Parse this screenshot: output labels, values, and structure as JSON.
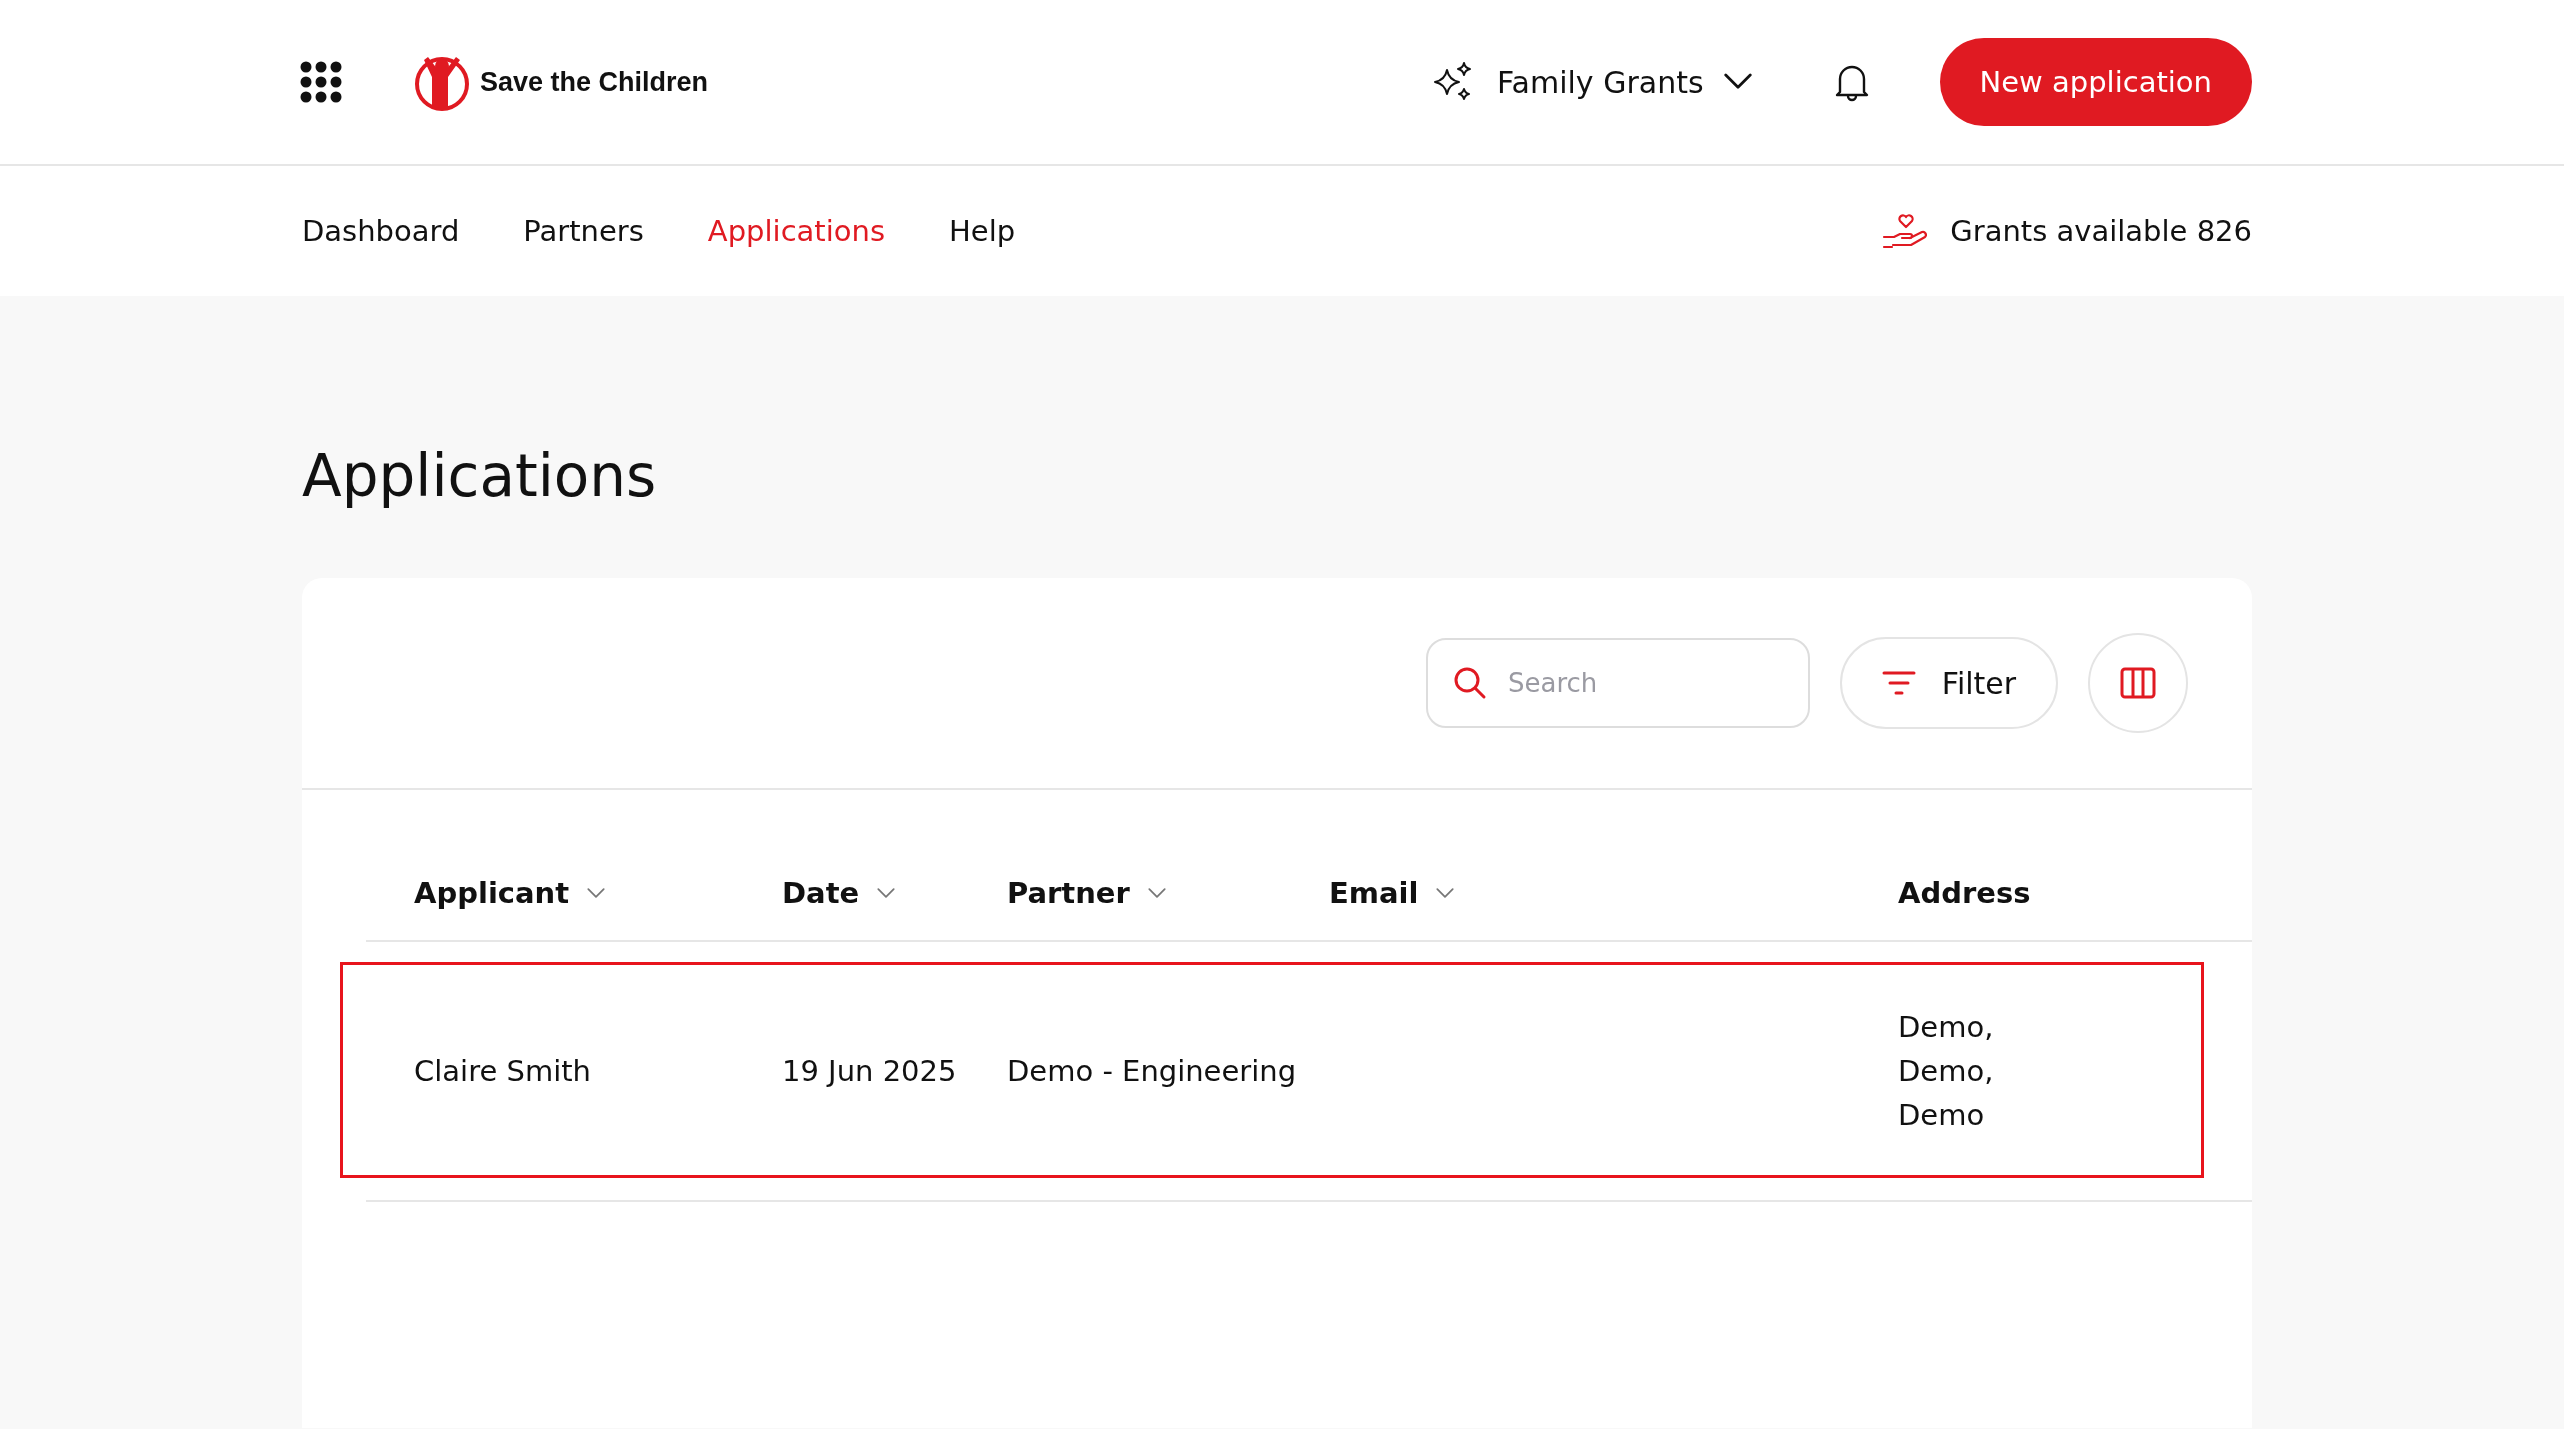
{
  "header": {
    "logo_text": "Save the Children",
    "programme": "Family Grants",
    "new_button": "New application"
  },
  "nav": {
    "items": [
      {
        "label": "Dashboard",
        "selected": false
      },
      {
        "label": "Partners",
        "selected": false
      },
      {
        "label": "Applications",
        "selected": true
      },
      {
        "label": "Help",
        "selected": false
      }
    ],
    "grants_label": "Grants available 826"
  },
  "page_title": "Applications",
  "toolbar": {
    "search": {
      "placeholder": "Search"
    },
    "filter_button": "Filter"
  },
  "table": {
    "columns": [
      {
        "label": "Applicant",
        "sortable": true
      },
      {
        "label": "Date",
        "sortable": true
      },
      {
        "label": "Partner",
        "sortable": true
      },
      {
        "label": "Email",
        "sortable": true
      },
      {
        "label": "Address",
        "sortable": false
      }
    ],
    "rows": [
      {
        "selected": true,
        "applicant": "Claire Smith",
        "date": "19 Jun 2025",
        "partner": "Demo - Engineering",
        "address_lines": [
          "Demo,",
          "Demo,",
          "Demo"
        ]
      }
    ]
  }
}
